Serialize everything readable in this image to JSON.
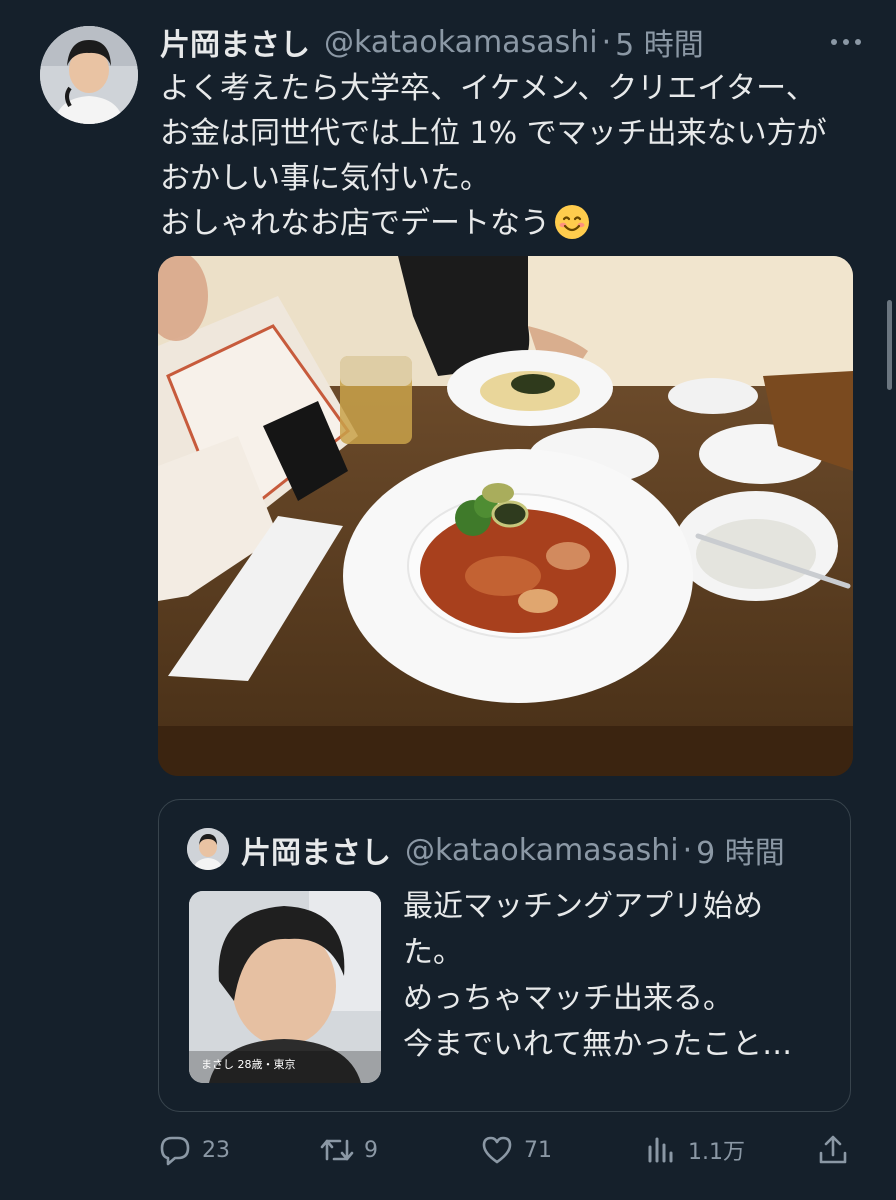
{
  "tweet": {
    "display_name": "片岡まさし",
    "handle": "@kataokamasashi",
    "separator": "·",
    "time": "5 時間",
    "text_lines": [
      "よく考えたら大学卒、イケメン、クリエイター、",
      "お金は同世代では上位 1% でマッチ出来ない方が",
      "おかしい事に気付いた。",
      "おしゃれなお店でデートなう"
    ],
    "emoji_icon": "smiling-face-emoji"
  },
  "quote": {
    "display_name": "片岡まさし",
    "handle": "@kataokamasashi",
    "separator": "·",
    "time": "9 時間",
    "text_lines": [
      "最近マッチングアプリ始め",
      "た。",
      "めっちゃマッチ出来る。",
      "今までいれて無かったこと…"
    ],
    "thumb_caption": "まさし 28歳・東京"
  },
  "actions": {
    "reply_count": "23",
    "retweet_count": "9",
    "like_count": "71",
    "views_count": "1.1万"
  },
  "colors": {
    "background": "#15202b",
    "text": "#e7e9ea",
    "secondary": "#8b98a5",
    "border": "#38444d"
  }
}
